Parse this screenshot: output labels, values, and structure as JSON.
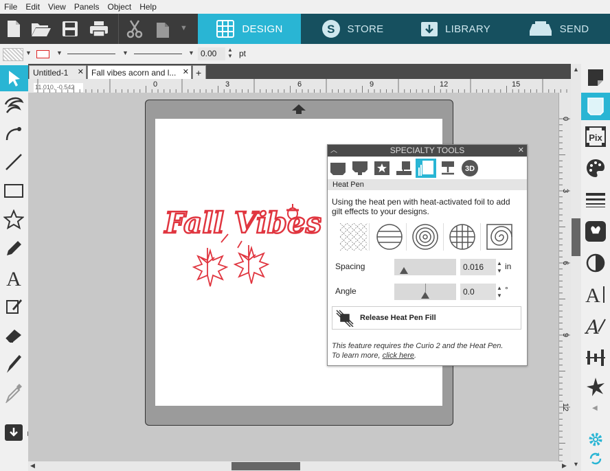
{
  "menu": [
    "File",
    "Edit",
    "View",
    "Panels",
    "Object",
    "Help"
  ],
  "nav_tabs": {
    "design": "DESIGN",
    "store": "STORE",
    "library": "LIBRARY",
    "send": "SEND"
  },
  "line_settings": {
    "width_value": "0.00",
    "unit": "pt"
  },
  "doc_tabs": [
    {
      "label": "Untitled-1"
    },
    {
      "label": "Fall vibes acorn and l..."
    }
  ],
  "ruler": {
    "coords": "11.010, -0.542",
    "ticks": [
      "0",
      "3",
      "6",
      "9",
      "12",
      "15"
    ],
    "vticks": [
      "0",
      "3",
      "6",
      "9",
      "12"
    ]
  },
  "design_text": "Fall Vibes",
  "specialty": {
    "title": "SPECIALTY TOOLS",
    "subtitle": "Heat Pen",
    "description": "Using the heat pen with heat-activated foil to add gilt effects to your designs.",
    "spacing_label": "Spacing",
    "spacing_value": "0.016",
    "spacing_unit": "in",
    "angle_label": "Angle",
    "angle_value": "0.0",
    "angle_unit": "°",
    "release_label": "Release Heat Pen Fill",
    "note": "This feature requires the Curio 2 and the Heat Pen.",
    "learn_prefix": "To learn more, ",
    "learn_link": "click here",
    "learn_suffix": ".",
    "threed": "3D"
  },
  "right_panel": {
    "pix": "Pix"
  },
  "colors": {
    "accent": "#29b5d4",
    "dark_tab": "#16505f",
    "toolbar": "#3b3b3b",
    "design_red": "#e0353f"
  }
}
